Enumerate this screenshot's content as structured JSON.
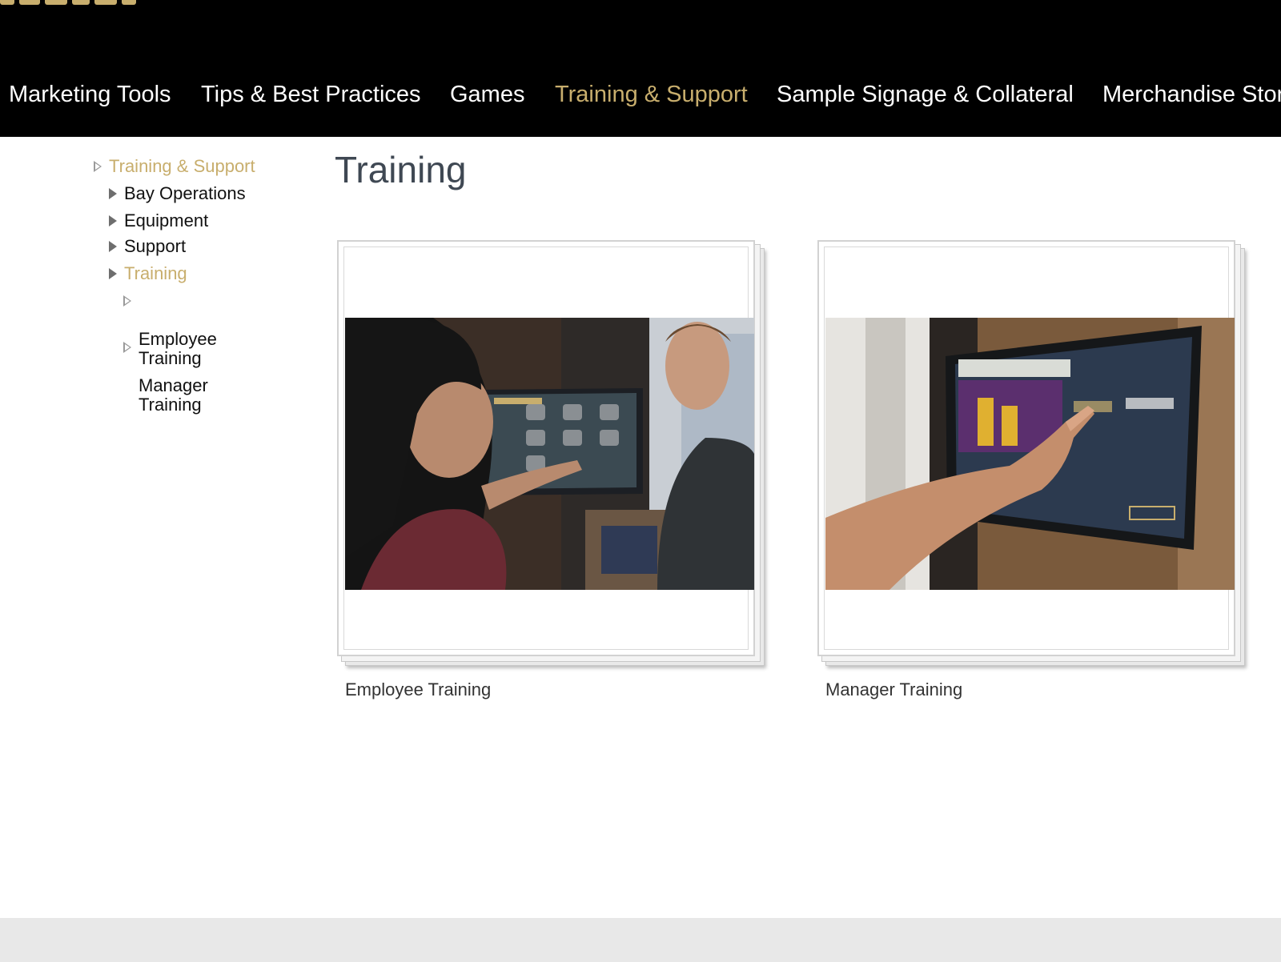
{
  "nav": {
    "items": [
      {
        "label": "Marketing Tools",
        "active": false
      },
      {
        "label": "Tips & Best Practices",
        "active": false
      },
      {
        "label": "Games",
        "active": false
      },
      {
        "label": "Training & Support",
        "active": true
      },
      {
        "label": "Sample Signage & Collateral",
        "active": false
      },
      {
        "label": "Merchandise Stor",
        "active": false
      }
    ]
  },
  "sidebar": {
    "items": [
      {
        "label": "Training & Support",
        "active": true
      },
      {
        "label": "Bay Operations",
        "active": false
      },
      {
        "label": "Equipment",
        "active": false
      },
      {
        "label": "Support",
        "active": false
      },
      {
        "label": "Training",
        "active": true
      },
      {
        "label": "Employee\nTraining",
        "active": false
      },
      {
        "label": "Manager\nTraining",
        "active": false
      }
    ]
  },
  "main": {
    "title": "Training",
    "cards": [
      {
        "caption": "Employee Training",
        "photo_icon": "employee-training-photo"
      },
      {
        "caption": "Manager Training",
        "photo_icon": "manager-training-photo"
      }
    ]
  },
  "colors": {
    "accent_gold": "#c8ae6d",
    "header_bg": "#000000",
    "title_gray": "#3f4853"
  }
}
